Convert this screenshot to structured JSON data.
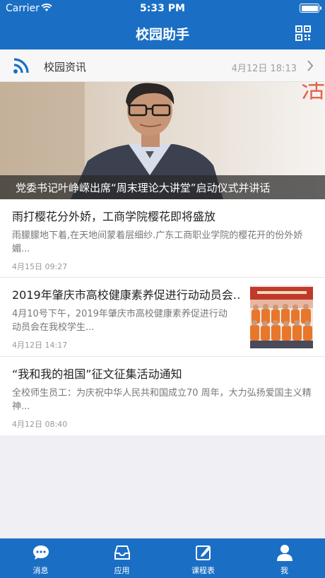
{
  "status_bar": {
    "carrier": "Carrier",
    "time": "5:33 PM"
  },
  "nav": {
    "title": "校园助手",
    "qr_icon": "qr-code-icon"
  },
  "news_header": {
    "icon": "rss-icon",
    "label": "校园资讯",
    "time": "4月12日 18:13"
  },
  "banner": {
    "caption": "党委书记叶峥嵘出席“周末理论大讲堂”启动仪式并讲话",
    "watermark_char": "活"
  },
  "news": [
    {
      "title": "雨打樱花分外娇，工商学院樱花即将盛放",
      "summary": "雨朦朦地下着,在天地间蒙着层细纱.广东工商职业学院的樱花开的份外娇媚...",
      "date": "4月15日 09:27",
      "has_thumb": false
    },
    {
      "title": "2019年肇庆市高校健康素养促进行动动员会…",
      "summary": "4月10号下午，2019年肇庆市高校健康素养促进行动动员会在我校学生...",
      "date": "4月12日 14:17",
      "has_thumb": true
    },
    {
      "title": "“我和我的祖国”征文征集活动通知",
      "summary": "全校师生员工：为庆祝中华人民共和国成立70 周年，大力弘扬爱国主义精神...",
      "date": "4月12日 08:40",
      "has_thumb": false
    }
  ],
  "tabs": [
    {
      "label": "消息",
      "icon": "chat-bubble-icon"
    },
    {
      "label": "应用",
      "icon": "inbox-tray-icon"
    },
    {
      "label": "课程表",
      "icon": "edit-note-icon"
    },
    {
      "label": "我",
      "icon": "person-icon"
    }
  ],
  "colors": {
    "primary": "#1a6fc4",
    "background": "#efeff4",
    "date_gray": "#999999"
  }
}
